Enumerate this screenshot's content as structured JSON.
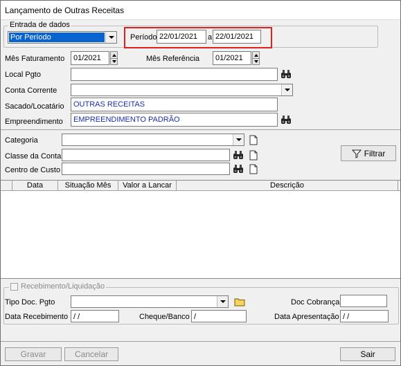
{
  "window": {
    "title": "Lançamento de Outras Receitas"
  },
  "entrada": {
    "group_label": "Entrada de dados",
    "mode_value": "Por Período",
    "periodo_label": "Período",
    "periodo_from": "22/01/2021",
    "periodo_sep": "a",
    "periodo_to": "22/01/2021",
    "highlight_color": "#e02020"
  },
  "form": {
    "mes_faturamento_label": "Mês Faturamento",
    "mes_faturamento_value": "01/2021",
    "mes_referencia_label": "Mês Referência",
    "mes_referencia_value": "01/2021",
    "local_pgto_label": "Local Pgto",
    "local_pgto_value": "",
    "conta_corrente_label": "Conta Corrente",
    "conta_corrente_value": "",
    "sacado_label": "Sacado/Locatário",
    "sacado_value": "OUTRAS RECEITAS",
    "empreendimento_label": "Empreendimento",
    "empreendimento_value": "EMPREENDIMENTO PADRÃO"
  },
  "filter": {
    "categoria_label": "Categoria",
    "categoria_value": "",
    "classe_label": "Classe da Conta",
    "classe_value": "",
    "centro_label": "Centro de Custo",
    "centro_value": "",
    "filtrar_label": "Filtrar"
  },
  "grid": {
    "columns": [
      "Data",
      "Situação Mês",
      "Valor a Lancar",
      "Descrição"
    ]
  },
  "recebimento": {
    "group_label": "Recebimento/Liquidação",
    "checked": false,
    "tipo_doc_label": "Tipo Doc. Pgto",
    "tipo_doc_value": "",
    "doc_cobranca_label": "Doc Cobrança",
    "doc_cobranca_value": "",
    "data_recebimento_label": "Data Recebimento",
    "data_recebimento_value": " /  /",
    "cheque_label": "Cheque/Banco",
    "cheque_value": "/",
    "data_apresentacao_label": "Data Apresentação",
    "data_apresentacao_value": " /  /"
  },
  "buttons": {
    "gravar": "Gravar",
    "cancelar": "Cancelar",
    "sair": "Sair"
  }
}
